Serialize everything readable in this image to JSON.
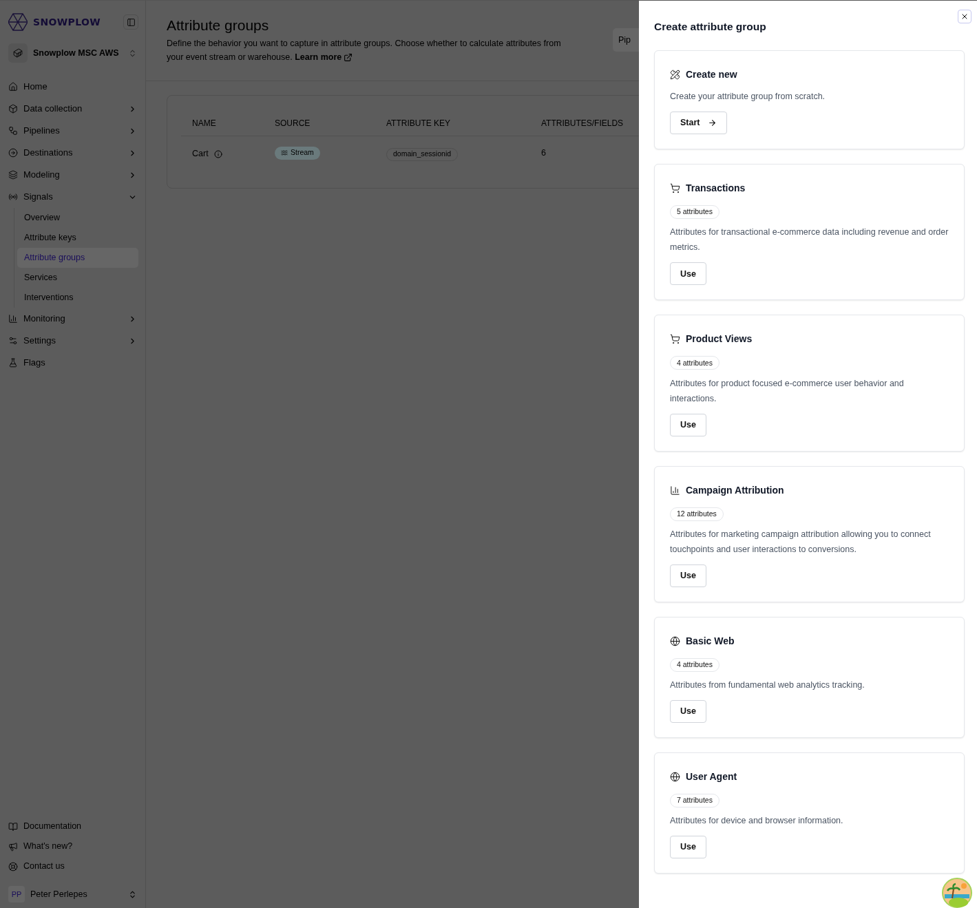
{
  "sidebar": {
    "brand": "SNOWPLOW",
    "workspace": "Snowplow MSC AWS",
    "items": [
      {
        "label": "Home"
      },
      {
        "label": "Data collection",
        "expanded": false
      },
      {
        "label": "Pipelines",
        "expanded": false
      },
      {
        "label": "Destinations",
        "expanded": false
      },
      {
        "label": "Modeling",
        "expanded": false
      },
      {
        "label": "Signals",
        "expanded": true,
        "children": [
          {
            "label": "Overview",
            "selected": false
          },
          {
            "label": "Attribute keys",
            "selected": false
          },
          {
            "label": "Attribute groups",
            "selected": true
          },
          {
            "label": "Services",
            "selected": false
          },
          {
            "label": "Interventions",
            "selected": false
          }
        ]
      },
      {
        "label": "Monitoring",
        "expanded": false
      },
      {
        "label": "Settings",
        "expanded": false
      },
      {
        "label": "Flags"
      }
    ],
    "footer_links": [
      "Documentation",
      "What's new?",
      "Contact us"
    ],
    "user": {
      "initials": "PP",
      "name": "Peter Perlepes"
    }
  },
  "page": {
    "title": "Attribute groups",
    "description": "Define the behavior you want to capture in attribute groups. Choose whether to calculate attributes from your event stream or warehouse.",
    "learn_more": "Learn more",
    "header_button": "Pip",
    "table": {
      "columns": [
        "NAME",
        "SOURCE",
        "ATTRIBUTE KEY",
        "ATTRIBUTES/FIELDS"
      ],
      "rows": [
        {
          "name": "Cart",
          "source": "Stream",
          "attribute_key": "domain_sessionid",
          "attributes": "6"
        }
      ]
    }
  },
  "drawer": {
    "title": "Create attribute group",
    "cards": [
      {
        "kind": "create",
        "title": "Create new",
        "description": "Create your attribute group from scratch.",
        "button": "Start"
      },
      {
        "kind": "template",
        "title": "Transactions",
        "count": "5 attributes",
        "description": "Attributes for transactional e-commerce data including revenue and order metrics.",
        "button": "Use"
      },
      {
        "kind": "template",
        "title": "Product Views",
        "count": "4 attributes",
        "description": "Attributes for product focused e-commerce user behavior and interactions.",
        "button": "Use"
      },
      {
        "kind": "template",
        "title": "Campaign Attribution",
        "count": "12 attributes",
        "description": "Attributes for marketing campaign attribution allowing you to connect touchpoints and user interactions to conversions.",
        "button": "Use"
      },
      {
        "kind": "template",
        "title": "Basic Web",
        "count": "4 attributes",
        "description": "Attributes from fundamental web analytics tracking.",
        "button": "Use"
      },
      {
        "kind": "template",
        "title": "User Agent",
        "count": "7 attributes",
        "description": "Attributes for device and browser information.",
        "button": "Use"
      }
    ]
  }
}
